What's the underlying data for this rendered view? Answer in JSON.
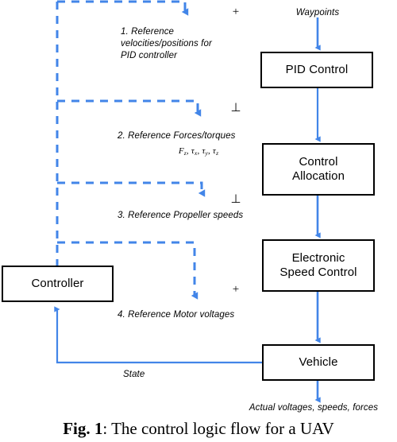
{
  "figure": {
    "caption_label": "Fig. 1",
    "caption_separator": ": ",
    "caption_text": "The control logic flow for a UAV"
  },
  "colors": {
    "flow_arrow": "#4285e8",
    "dashed_line": "#4285e8",
    "box_border": "#000000",
    "background": "#ffffff",
    "text": "#000000"
  },
  "diagram": {
    "blocks": [
      {
        "id": "pid-control",
        "label": "PID Control"
      },
      {
        "id": "control-allocation",
        "label_line1": "Control",
        "label_line2": "Allocation"
      },
      {
        "id": "electronic-speed-control",
        "label_line1": "Electronic",
        "label_line2": "Speed Control"
      },
      {
        "id": "vehicle",
        "label": "Vehicle"
      },
      {
        "id": "controller",
        "label": "Controller"
      }
    ],
    "signals": {
      "waypoints": "Waypoints",
      "state": "State",
      "actual_outputs": "Actual voltages, speeds, forces"
    },
    "reference_labels": [
      {
        "id": "ref-1",
        "text": "1. Reference\nvelocities/positions for\nPID controller"
      },
      {
        "id": "ref-2",
        "text": "2. Reference Forces/torques"
      },
      {
        "id": "ref-3",
        "text": "3. Reference Propeller speeds"
      },
      {
        "id": "ref-4",
        "text": "4. Reference Motor voltages"
      }
    ],
    "formula": {
      "f_symbol": "F",
      "f_sub": "z",
      "sep1": ", τ",
      "sub_x": "x",
      "sep2": ", τ",
      "sub_y": "y",
      "sep3": ", τ",
      "sub_z": "z"
    },
    "operators": [
      {
        "id": "op-1",
        "symbol": "+"
      },
      {
        "id": "op-2",
        "symbol": "⊥"
      },
      {
        "id": "op-3",
        "symbol": "⊥"
      },
      {
        "id": "op-4",
        "symbol": "+"
      }
    ]
  }
}
